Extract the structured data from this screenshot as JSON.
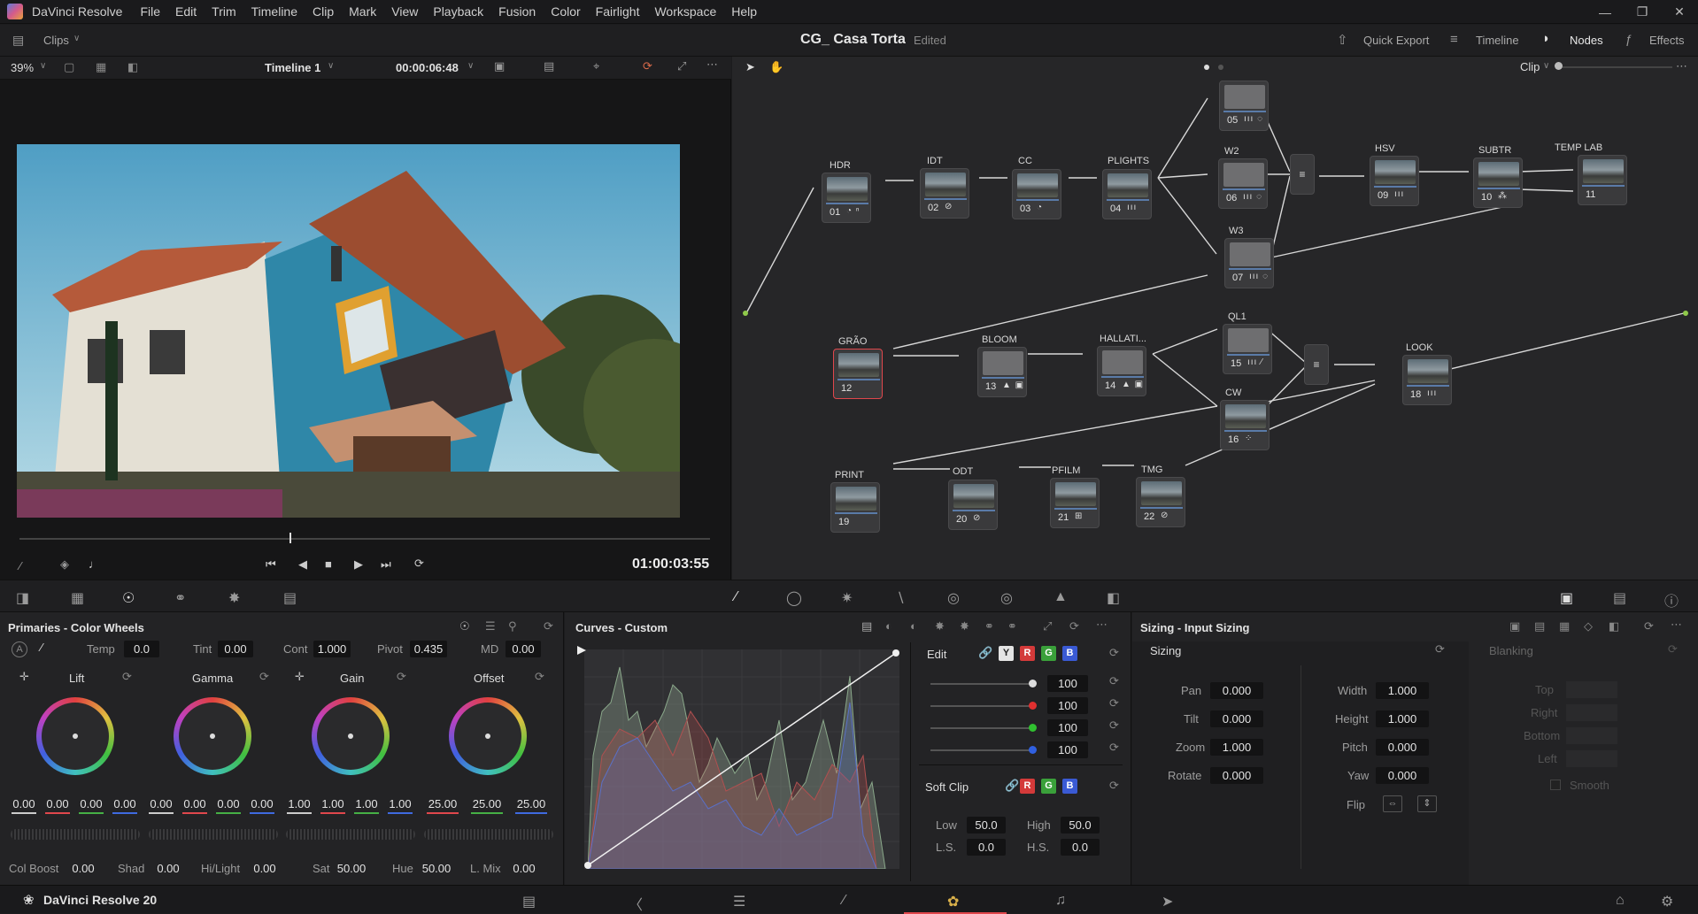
{
  "menu": {
    "app_name": "DaVinci Resolve",
    "items": [
      "File",
      "Edit",
      "Trim",
      "Timeline",
      "Clip",
      "Mark",
      "View",
      "Playback",
      "Fusion",
      "Color",
      "Fairlight",
      "Workspace",
      "Help"
    ]
  },
  "toolbar": {
    "clips_label": "Clips",
    "project_title": "CG_ Casa Torta",
    "edited_label": "Edited",
    "quick_export": "Quick Export",
    "timeline": "Timeline",
    "nodes": "Nodes",
    "effects": "Effects"
  },
  "viewer_bar": {
    "zoom": "39%",
    "timeline_name": "Timeline 1",
    "timecode": "00:00:06:48",
    "clip_label": "Clip"
  },
  "transport": {
    "timecode": "01:00:03:55"
  },
  "nodes": [
    {
      "id": "n05",
      "label": "",
      "num": "05",
      "icons": "ııı ◌"
    },
    {
      "id": "n01",
      "label": "HDR",
      "num": "01",
      "icons": "◔ ⁿ"
    },
    {
      "id": "n02",
      "label": "IDT",
      "num": "02",
      "icons": "⊘"
    },
    {
      "id": "n03",
      "label": "CC",
      "num": "03",
      "icons": "◔"
    },
    {
      "id": "n04",
      "label": "PLIGHTS",
      "num": "04",
      "icons": "ııı"
    },
    {
      "id": "n06",
      "label": "W2",
      "num": "06",
      "icons": "ııı ◌"
    },
    {
      "id": "n09",
      "label": "HSV",
      "num": "09",
      "icons": "ııı"
    },
    {
      "id": "n10",
      "label": "SUBTR",
      "num": "10",
      "icons": "⁂"
    },
    {
      "id": "n11",
      "label": "TEMP LAB",
      "num": "11",
      "icons": ""
    },
    {
      "id": "n07",
      "label": "W3",
      "num": "07",
      "icons": "ııı ◌"
    },
    {
      "id": "n12",
      "label": "GRÃO",
      "num": "12",
      "icons": ""
    },
    {
      "id": "n13",
      "label": "BLOOM",
      "num": "13",
      "icons": "▲ ▣"
    },
    {
      "id": "n14",
      "label": "HALLATI...",
      "num": "14",
      "icons": "▲ ▣"
    },
    {
      "id": "n15",
      "label": "QL1",
      "num": "15",
      "icons": "ııı ⁄"
    },
    {
      "id": "n16",
      "label": "CW",
      "num": "16",
      "icons": "⁘"
    },
    {
      "id": "n18",
      "label": "LOOK",
      "num": "18",
      "icons": "ııı"
    },
    {
      "id": "n19",
      "label": "PRINT",
      "num": "19",
      "icons": ""
    },
    {
      "id": "n20",
      "label": "ODT",
      "num": "20",
      "icons": "⊘"
    },
    {
      "id": "n21",
      "label": "PFILM",
      "num": "21",
      "icons": "⊞"
    },
    {
      "id": "n22",
      "label": "TMG",
      "num": "22",
      "icons": "⊘"
    }
  ],
  "primaries": {
    "title": "Primaries - Color Wheels",
    "temp_label": "Temp",
    "temp": "0.0",
    "tint_label": "Tint",
    "tint": "0.00",
    "cont_label": "Cont",
    "cont": "1.000",
    "pivot_label": "Pivot",
    "pivot": "0.435",
    "md_label": "MD",
    "md": "0.00",
    "wheels": [
      {
        "name": "Lift",
        "values": [
          "0.00",
          "0.00",
          "0.00",
          "0.00"
        ]
      },
      {
        "name": "Gamma",
        "values": [
          "0.00",
          "0.00",
          "0.00",
          "0.00"
        ]
      },
      {
        "name": "Gain",
        "values": [
          "1.00",
          "1.00",
          "1.00",
          "1.00"
        ]
      },
      {
        "name": "Offset",
        "values": [
          "25.00",
          "25.00",
          "25.00"
        ]
      }
    ],
    "col_boost_label": "Col Boost",
    "col_boost": "0.00",
    "shad_label": "Shad",
    "shad": "0.00",
    "hilight_label": "Hi/Light",
    "hilight": "0.00",
    "sat_label": "Sat",
    "sat": "50.00",
    "hue_label": "Hue",
    "hue": "50.00",
    "lmix_label": "L. Mix",
    "lmix": "0.00"
  },
  "curves": {
    "title": "Curves - Custom",
    "edit_label": "Edit",
    "channels": [
      "Y",
      "R",
      "G",
      "B"
    ],
    "intensity": [
      "100",
      "100",
      "100",
      "100"
    ],
    "soft_clip_label": "Soft Clip",
    "low_label": "Low",
    "low": "50.0",
    "high_label": "High",
    "high": "50.0",
    "ls_label": "L.S.",
    "ls": "0.0",
    "hs_label": "H.S.",
    "hs": "0.0"
  },
  "sizing": {
    "title": "Sizing - Input Sizing",
    "section": "Sizing",
    "pan_label": "Pan",
    "pan": "0.000",
    "tilt_label": "Tilt",
    "tilt": "0.000",
    "zoom_label": "Zoom",
    "zoom": "1.000",
    "rotate_label": "Rotate",
    "rotate": "0.000",
    "width_label": "Width",
    "width": "1.000",
    "height_label": "Height",
    "height": "1.000",
    "pitch_label": "Pitch",
    "pitch": "0.000",
    "yaw_label": "Yaw",
    "yaw": "0.000",
    "flip_label": "Flip",
    "blanking": "Blanking",
    "top": "Top",
    "right": "Right",
    "bottom": "Bottom",
    "left": "Left",
    "smooth": "Smooth"
  },
  "status": {
    "app_version": "DaVinci Resolve 20"
  },
  "colors": {
    "accent_red": "#e0474c",
    "node_green": "#8fc94a",
    "node_blue": "#3f9fe0"
  }
}
